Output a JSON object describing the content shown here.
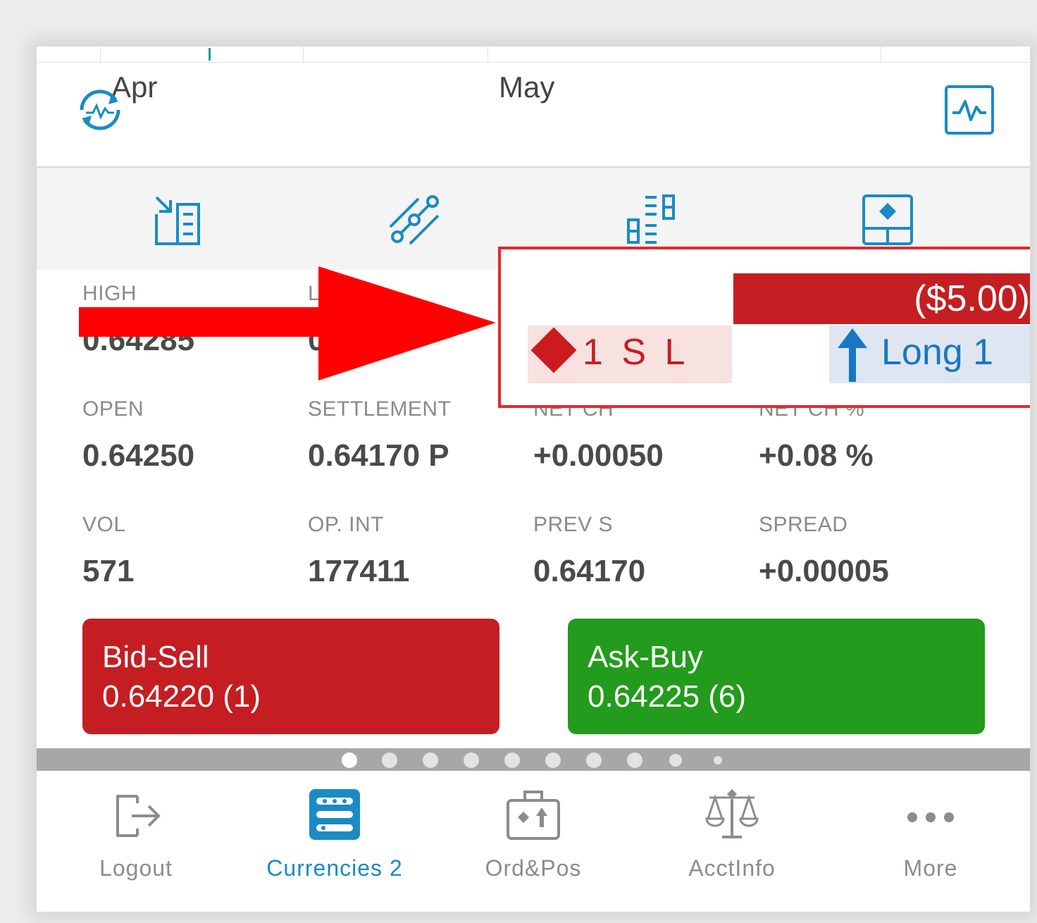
{
  "chart_header": {
    "month_left": "Apr",
    "month_right": "May"
  },
  "stats": [
    {
      "label": "HIGH",
      "value": "0.64285"
    },
    {
      "label": "L",
      "value": "0"
    },
    {
      "label": "",
      "value": ""
    },
    {
      "label": "",
      "value": ""
    },
    {
      "label": "OPEN",
      "value": "0.64250"
    },
    {
      "label": "SETTLEMENT",
      "value": "0.64170 P"
    },
    {
      "label": "NET CH",
      "value": "+0.00050"
    },
    {
      "label": "NET CH %",
      "value": "+0.08 %"
    },
    {
      "label": "VOL",
      "value": "571"
    },
    {
      "label": "OP. INT",
      "value": "177411"
    },
    {
      "label": "PREV S",
      "value": "0.64170"
    },
    {
      "label": "SPREAD",
      "value": "+0.00005"
    }
  ],
  "position": {
    "pnl": "($5.00)",
    "stop_loss": "1 S L",
    "long": "Long 1"
  },
  "trade": {
    "sell_label": "Bid-Sell",
    "sell_price": "0.64220 (1)",
    "buy_label": "Ask-Buy",
    "buy_price": "0.64225 (6)"
  },
  "pager": {
    "active_index": 0,
    "count": 10
  },
  "tabs": [
    {
      "label": "Logout",
      "icon": "logout-icon"
    },
    {
      "label": "Currencies 2",
      "icon": "currencies-icon",
      "active": true
    },
    {
      "label": "Ord&Pos",
      "icon": "briefcase-icon"
    },
    {
      "label": "AcctInfo",
      "icon": "scales-icon"
    },
    {
      "label": "More",
      "icon": "more-icon"
    }
  ],
  "colors": {
    "accent_blue": "#1a8bc4",
    "sell_red": "#c41e22",
    "buy_green": "#239b1c",
    "annotation_red": "#ff0000"
  }
}
